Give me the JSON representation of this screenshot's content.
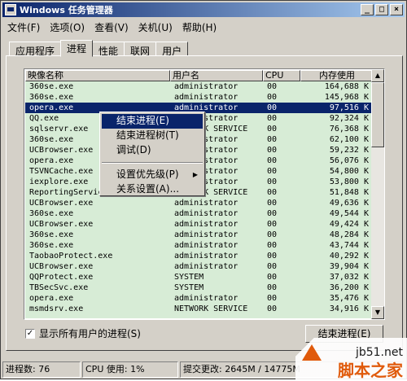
{
  "window": {
    "title": "Windows 任务管理器",
    "btn_min": "_",
    "btn_max": "□",
    "btn_close": "×"
  },
  "menubar": [
    "文件(F)",
    "选项(O)",
    "查看(V)",
    "关机(U)",
    "帮助(H)"
  ],
  "tabs": [
    "应用程序",
    "进程",
    "性能",
    "联网",
    "用户"
  ],
  "active_tab": "进程",
  "columns": [
    "映像名称",
    "用户名",
    "CPU",
    "内存使用"
  ],
  "processes": [
    {
      "name": "360se.exe",
      "user": "administrator",
      "cpu": "00",
      "mem": "164,688 K"
    },
    {
      "name": "360se.exe",
      "user": "administrator",
      "cpu": "00",
      "mem": "145,968 K"
    },
    {
      "name": "opera.exe",
      "user": "administrator",
      "cpu": "00",
      "mem": "97,516 K"
    },
    {
      "name": "QQ.exe",
      "user": "administrator",
      "cpu": "00",
      "mem": "92,324 K"
    },
    {
      "name": "sqlservr.exe",
      "user": "NETWORK SERVICE",
      "cpu": "00",
      "mem": "76,368 K"
    },
    {
      "name": "360se.exe",
      "user": "administrator",
      "cpu": "00",
      "mem": "62,100 K"
    },
    {
      "name": "UCBrowser.exe",
      "user": "administrator",
      "cpu": "00",
      "mem": "59,232 K"
    },
    {
      "name": "opera.exe",
      "user": "administrator",
      "cpu": "00",
      "mem": "56,076 K"
    },
    {
      "name": "TSVNCache.exe",
      "user": "administrator",
      "cpu": "00",
      "mem": "54,800 K"
    },
    {
      "name": "iexplore.exe",
      "user": "administrator",
      "cpu": "00",
      "mem": "53,800 K"
    },
    {
      "name": "ReportingServicesService.exe",
      "user": "NETWORK SERVICE",
      "cpu": "00",
      "mem": "51,848 K"
    },
    {
      "name": "UCBrowser.exe",
      "user": "administrator",
      "cpu": "00",
      "mem": "49,636 K"
    },
    {
      "name": "360se.exe",
      "user": "administrator",
      "cpu": "00",
      "mem": "49,544 K"
    },
    {
      "name": "UCBrowser.exe",
      "user": "administrator",
      "cpu": "00",
      "mem": "49,424 K"
    },
    {
      "name": "360se.exe",
      "user": "administrator",
      "cpu": "00",
      "mem": "48,284 K"
    },
    {
      "name": "360se.exe",
      "user": "administrator",
      "cpu": "00",
      "mem": "43,744 K"
    },
    {
      "name": "TaobaoProtect.exe",
      "user": "administrator",
      "cpu": "00",
      "mem": "40,292 K"
    },
    {
      "name": "UCBrowser.exe",
      "user": "administrator",
      "cpu": "00",
      "mem": "39,904 K"
    },
    {
      "name": "QQProtect.exe",
      "user": "SYSTEM",
      "cpu": "00",
      "mem": "37,032 K"
    },
    {
      "name": "TBSecSvc.exe",
      "user": "SYSTEM",
      "cpu": "00",
      "mem": "36,200 K"
    },
    {
      "name": "opera.exe",
      "user": "administrator",
      "cpu": "00",
      "mem": "35,476 K"
    },
    {
      "name": "msmdsrv.exe",
      "user": "NETWORK SERVICE",
      "cpu": "00",
      "mem": "34,916 K"
    }
  ],
  "selected_row": 2,
  "context_menu": [
    "结束进程(E)",
    "结束进程树(T)",
    "调试(D)",
    "设置优先级(P)",
    "关系设置(A)..."
  ],
  "show_all_users": {
    "label": "显示所有用户的进程(S)",
    "checked": "✓"
  },
  "end_process_button": "结束进程(E)",
  "statusbar": {
    "processes": "进程数: 76",
    "cpu": "CPU 使用: 1%",
    "commit": "提交更改: 2645M / 14775M"
  },
  "watermark": {
    "site": "jb51.net",
    "name": "脚本之家"
  },
  "scroll_up": "▲",
  "scroll_down": "▼",
  "submenu_arrow": "▶"
}
